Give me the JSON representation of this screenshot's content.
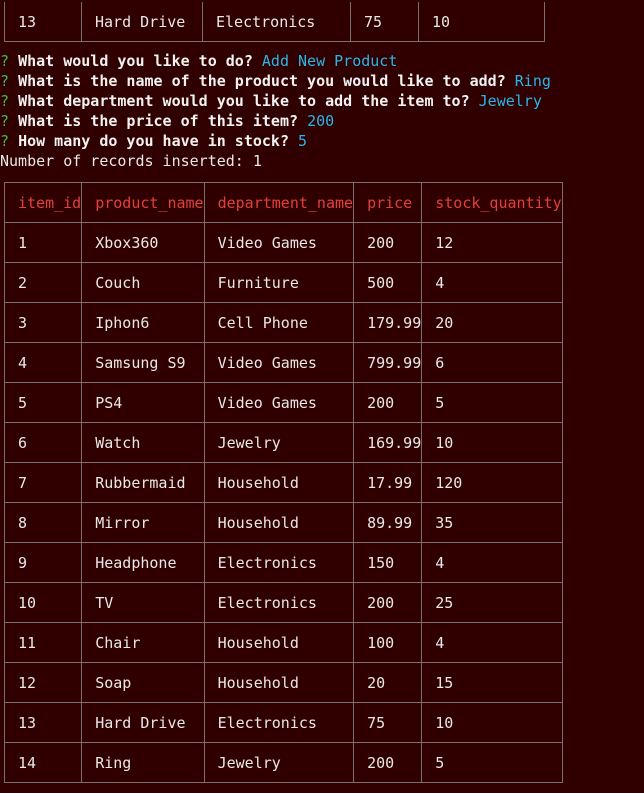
{
  "previous_row": {
    "item_id": "13",
    "product_name": "Hard Drive",
    "department_name": "Electronics",
    "price": "75",
    "stock_quantity": "10"
  },
  "prompts": [
    {
      "mark": "?",
      "question": "What would you like to do?",
      "answer": "Add New Product"
    },
    {
      "mark": "?",
      "question": "What is the name of the product you would like to add?",
      "answer": "Ring"
    },
    {
      "mark": "?",
      "question": "What department would you like to add the item to?",
      "answer": "Jewelry"
    },
    {
      "mark": "?",
      "question": "What is the price of this item?",
      "answer": "200"
    },
    {
      "mark": "?",
      "question": "How many do you have in stock?",
      "answer": "5"
    }
  ],
  "status_message": "Number of records inserted: 1",
  "table": {
    "headers": [
      "item_id",
      "product_name",
      "department_name",
      "price",
      "stock_quantity"
    ],
    "rows": [
      [
        "1",
        "Xbox360",
        "Video Games",
        "200",
        "12"
      ],
      [
        "2",
        "Couch",
        "Furniture",
        "500",
        "4"
      ],
      [
        "3",
        "Iphon6",
        "Cell Phone",
        "179.99",
        "20"
      ],
      [
        "4",
        "Samsung S9",
        "Video Games",
        "799.99",
        "6"
      ],
      [
        "5",
        "PS4",
        "Video Games",
        "200",
        "5"
      ],
      [
        "6",
        "Watch",
        "Jewelry",
        "169.99",
        "10"
      ],
      [
        "7",
        "Rubbermaid",
        "Household",
        "17.99",
        "120"
      ],
      [
        "8",
        "Mirror",
        "Household",
        "89.99",
        "35"
      ],
      [
        "9",
        "Headphone",
        "Electronics",
        "150",
        "4"
      ],
      [
        "10",
        "TV",
        "Electronics",
        "200",
        "25"
      ],
      [
        "11",
        "Chair",
        "Household",
        "100",
        "4"
      ],
      [
        "12",
        "Soap",
        "Household",
        "20",
        "15"
      ],
      [
        "13",
        "Hard Drive",
        "Electronics",
        "75",
        "10"
      ],
      [
        "14",
        "Ring",
        "Jewelry",
        "200",
        "5"
      ]
    ]
  },
  "colors": {
    "background": "#300000",
    "header_text": "#e0413b",
    "prompt_mark": "#3fb950",
    "answer_text": "#2bb5e8",
    "border": "#7a6e6e"
  }
}
